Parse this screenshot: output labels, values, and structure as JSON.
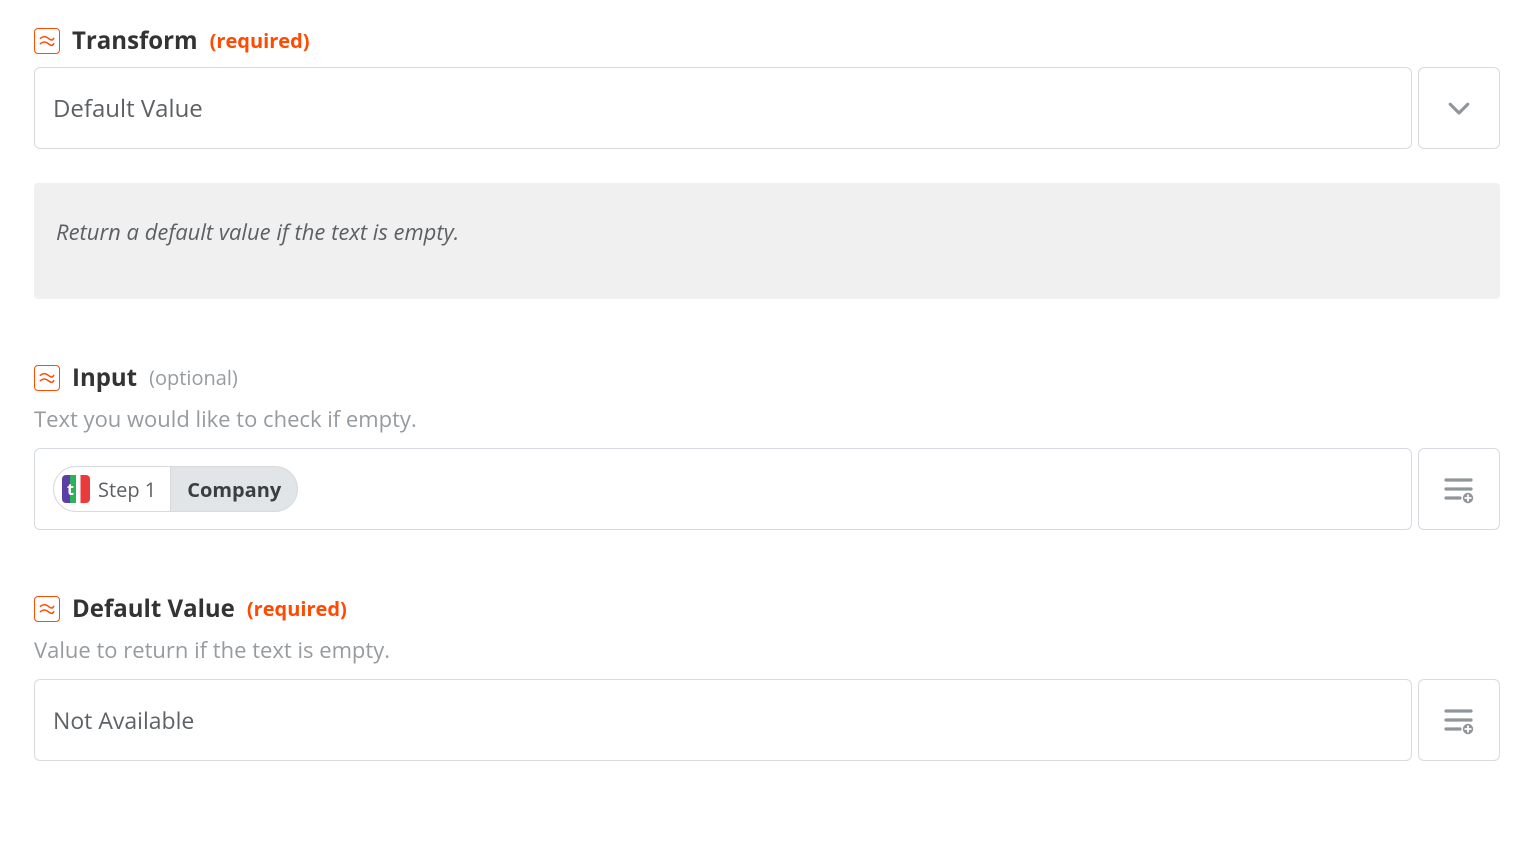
{
  "fields": {
    "transform": {
      "label": "Transform",
      "hint": "(required)",
      "hint_type": "required",
      "selected_value": "Default Value",
      "description": "Return a default value if the text is empty."
    },
    "input": {
      "label": "Input",
      "hint": "(optional)",
      "hint_type": "optional",
      "help": "Text you would like to check if empty.",
      "token": {
        "step_label": "Step 1",
        "field_label": "Company"
      }
    },
    "default_value": {
      "label": "Default Value",
      "hint": "(required)",
      "hint_type": "required",
      "help": "Value to return if the text is empty.",
      "value": "Not Available"
    }
  },
  "icons": {
    "zap": "zap-icon",
    "chevron_down": "chevron-down-icon",
    "insert_data": "insert-data-icon",
    "app": "typeform-app-icon"
  }
}
